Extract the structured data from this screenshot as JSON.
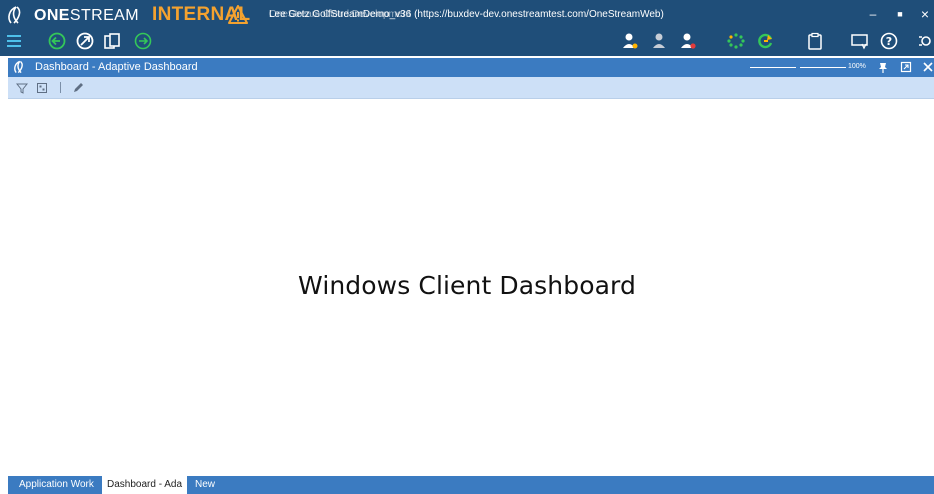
{
  "titlebar": {
    "brand_bold": "ONE",
    "brand_rest": "STREAM",
    "environment": "INTERNAL",
    "window_title": "OneStream Cloud Development",
    "window_subtitle": "Lee Getz GolfStreamDemo_v36 (https://buxdev-dev.onestreamtest.com/OneStreamWeb)",
    "minimize": "–",
    "maximize": "■",
    "close": "×"
  },
  "toolbar": {
    "icons": [
      "menu-icon",
      "back-icon",
      "navigate-icon",
      "copy-icon",
      "forward-icon",
      "user-settings-icon",
      "user-icon",
      "user-remove-icon",
      "loading-icon",
      "refresh-icon",
      "clipboard-icon",
      "task-icon",
      "help-icon",
      "more-icon"
    ]
  },
  "panel": {
    "title": "Dashboard - Adaptive Dashboard",
    "zoom": "100%"
  },
  "content": {
    "placeholder": "Windows Client Dashboard"
  },
  "tabs": [
    {
      "label": "Application Work",
      "active": false
    },
    {
      "label": "Dashboard - Ada",
      "active": true
    },
    {
      "label": "New",
      "active": false
    }
  ],
  "colors": {
    "titlebar": "#1f4e79",
    "panel_header": "#3b7bc1",
    "panel_tools": "#cde0f7",
    "environment": "#f4a22f",
    "go_green": "#34c759"
  }
}
